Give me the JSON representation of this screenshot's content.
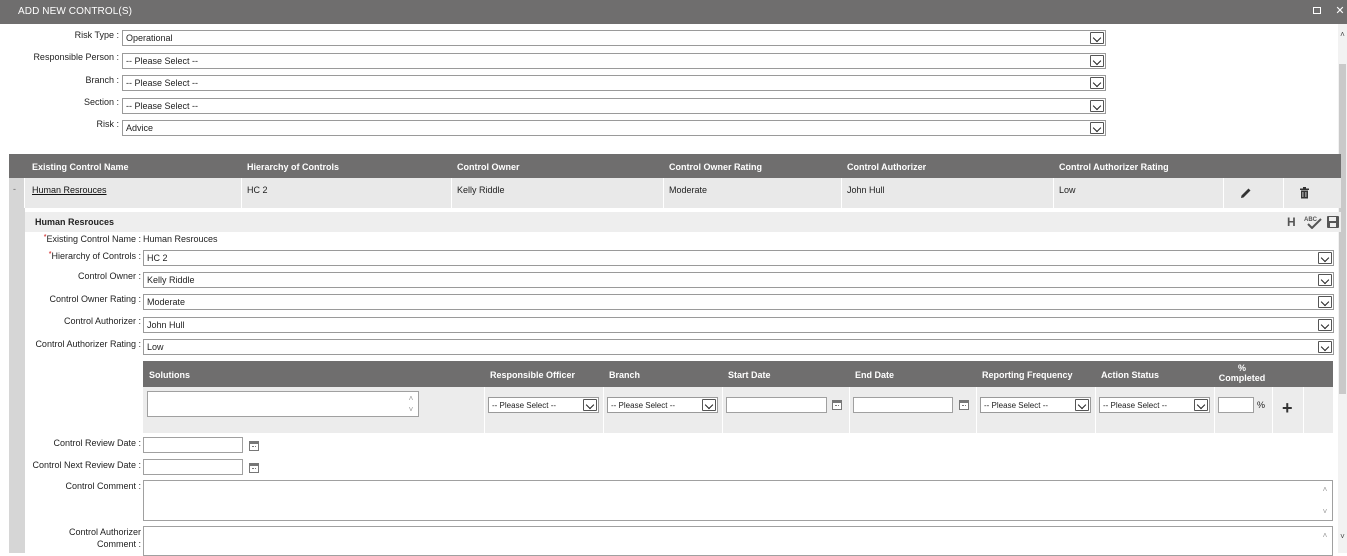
{
  "window": {
    "title": "ADD NEW CONTROL(S)"
  },
  "top_form": {
    "risk_type": {
      "label": "Risk Type :",
      "value": "Operational"
    },
    "responsible_person": {
      "label": "Responsible Person :",
      "value": "-- Please Select --"
    },
    "branch": {
      "label": "Branch :",
      "value": "-- Please Select --"
    },
    "section": {
      "label": "Section :",
      "value": "-- Please Select --"
    },
    "risk": {
      "label": "Risk :",
      "value": "Advice"
    }
  },
  "table": {
    "headers": [
      "Existing Control Name",
      "Hierarchy of Controls",
      "Control Owner",
      "Control Owner Rating",
      "Control Authorizer",
      "Control Authorizer Rating"
    ],
    "row": {
      "name": "Human Resrouces",
      "hierarchy": "HC 2",
      "owner": "Kelly Riddle",
      "owner_rating": "Moderate",
      "authorizer": "John Hull",
      "authorizer_rating": "Low",
      "collapse_glyph": "-"
    }
  },
  "detail": {
    "title": "Human Resrouces",
    "toolbar": {
      "h_label": "H",
      "abc_label": "ABC"
    },
    "existing_name": {
      "label": "Existing Control Name :",
      "value": "Human Resrouces",
      "required": "*"
    },
    "hierarchy": {
      "label": "Hierarchy of Controls :",
      "value": "HC 2",
      "required": "*"
    },
    "owner": {
      "label": "Control Owner :",
      "value": "Kelly Riddle"
    },
    "owner_rating": {
      "label": "Control Owner Rating :",
      "value": "Moderate"
    },
    "authorizer": {
      "label": "Control Authorizer :",
      "value": "John Hull"
    },
    "authorizer_rating": {
      "label": "Control Authorizer Rating :",
      "value": "Low"
    },
    "review_date": {
      "label": "Control Review Date :"
    },
    "next_review_date": {
      "label": "Control Next Review Date :"
    },
    "comment": {
      "label": "Control Comment :"
    },
    "authorizer_comment": {
      "label_line1": "Control Authorizer",
      "label_line2": "Comment :"
    }
  },
  "solutions": {
    "headers": {
      "solutions": "Solutions",
      "responsible_officer": "Responsible Officer",
      "branch": "Branch",
      "start_date": "Start Date",
      "end_date": "End Date",
      "reporting_frequency": "Reporting Frequency",
      "action_status": "Action Status",
      "pct_line1": "%",
      "pct_line2": "Completed"
    },
    "row": {
      "responsible_officer": "-- Please Select --",
      "branch": "-- Please Select --",
      "reporting_frequency": "-- Please Select --",
      "action_status": "-- Please Select --",
      "pct_symbol": "%",
      "add_glyph": "+"
    }
  },
  "icons": {
    "edit": "pencil-icon",
    "delete": "trash-icon",
    "save": "floppy-icon",
    "spellcheck": "spellcheck-icon",
    "calendar": "calendar-icon"
  },
  "colors": {
    "header_bg": "#6f6e6e",
    "row_bg": "#e9e9e9",
    "text": "#222222"
  }
}
